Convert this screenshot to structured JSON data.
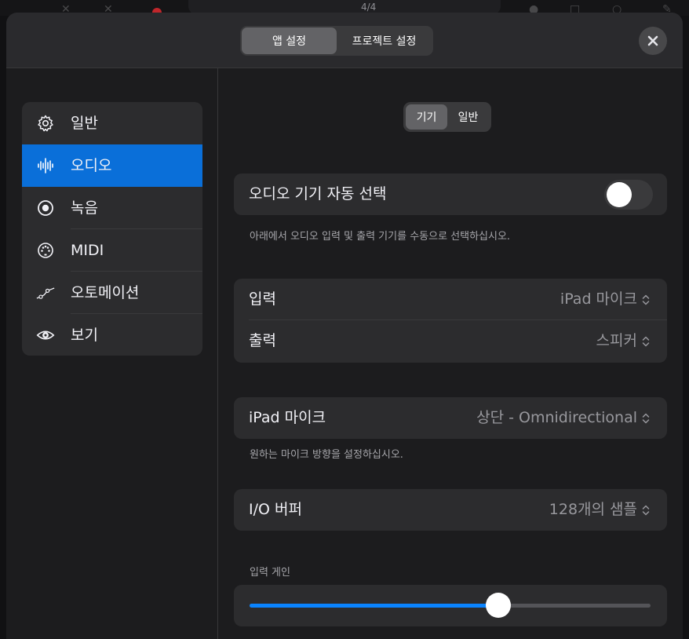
{
  "background": {
    "counter": "4/4"
  },
  "header": {
    "tabs": [
      {
        "label": "앱 설정",
        "active": true
      },
      {
        "label": "프로젝트 설정",
        "active": false
      }
    ],
    "close_icon": "close-icon"
  },
  "sidebar": {
    "items": [
      {
        "label": "일반",
        "icon": "gear-icon",
        "active": false
      },
      {
        "label": "오디오",
        "icon": "waveform-icon",
        "active": true
      },
      {
        "label": "녹음",
        "icon": "record-icon",
        "active": false
      },
      {
        "label": "MIDI",
        "icon": "midi-icon",
        "active": false
      },
      {
        "label": "오토메이션",
        "icon": "automation-icon",
        "active": false
      },
      {
        "label": "보기",
        "icon": "eye-icon",
        "active": false
      }
    ]
  },
  "subtabs": [
    {
      "label": "기기",
      "active": true
    },
    {
      "label": "일반",
      "active": false
    }
  ],
  "auto_select": {
    "label": "오디오 기기 자동 선택",
    "enabled": false,
    "hint": "아래에서 오디오 입력 및 출력 기기를 수동으로 선택하십시오."
  },
  "io": {
    "input_label": "입력",
    "input_value": "iPad 마이크",
    "output_label": "출력",
    "output_value": "스피커"
  },
  "mic": {
    "label": "iPad 마이크",
    "value": "상단 - Omnidirectional",
    "hint": "원하는 마이크 방향을 설정하십시오."
  },
  "buffer": {
    "label": "I/O 버퍼",
    "value": "128개의 샘플"
  },
  "gain": {
    "label": "입력 게인",
    "level": 0.62
  },
  "colors": {
    "accent": "#0a6fd9",
    "slider_fill": "#0a84ff"
  }
}
